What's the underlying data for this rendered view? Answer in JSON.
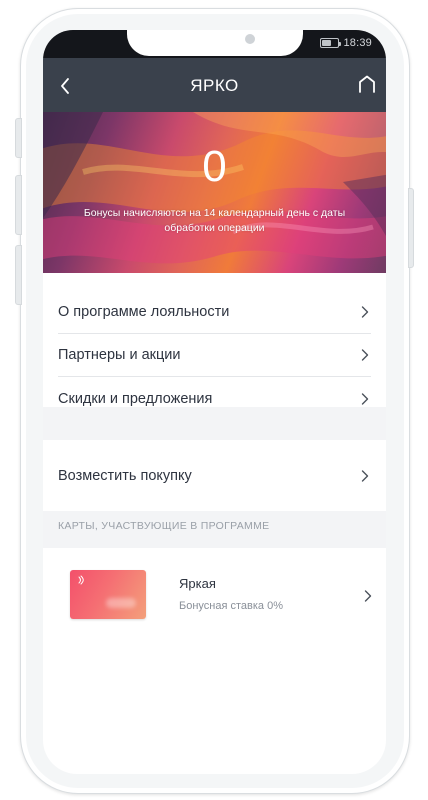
{
  "status_bar": {
    "time": "18:39"
  },
  "header": {
    "title": "ЯРКО"
  },
  "bonus": {
    "value": "0",
    "note": "Бонусы начисляются на 14 календарный день с даты обработки операции"
  },
  "menu": {
    "items": [
      {
        "label": "О программе лояльности"
      },
      {
        "label": "Партнеры и акции"
      },
      {
        "label": "Скидки и предложения"
      }
    ]
  },
  "compensate": {
    "label": "Возместить покупку"
  },
  "cards_section": {
    "header": "КАРТЫ, УЧАСТВУЮЩИЕ В ПРОГРАММЕ",
    "cards": [
      {
        "name": "Яркая",
        "rate": "Бонусная ставка 0%"
      }
    ]
  },
  "icons": {
    "back": "chevron-left-icon",
    "home": "home-icon",
    "row_arrow": "chevron-right-icon",
    "battery": "battery-icon",
    "contactless": "contactless-icon"
  },
  "colors": {
    "app_bar": "#3a414c",
    "status_bar": "#14161b",
    "text_primary": "#2e3440",
    "text_secondary": "#8a9099",
    "section_bg": "#f3f4f6"
  }
}
